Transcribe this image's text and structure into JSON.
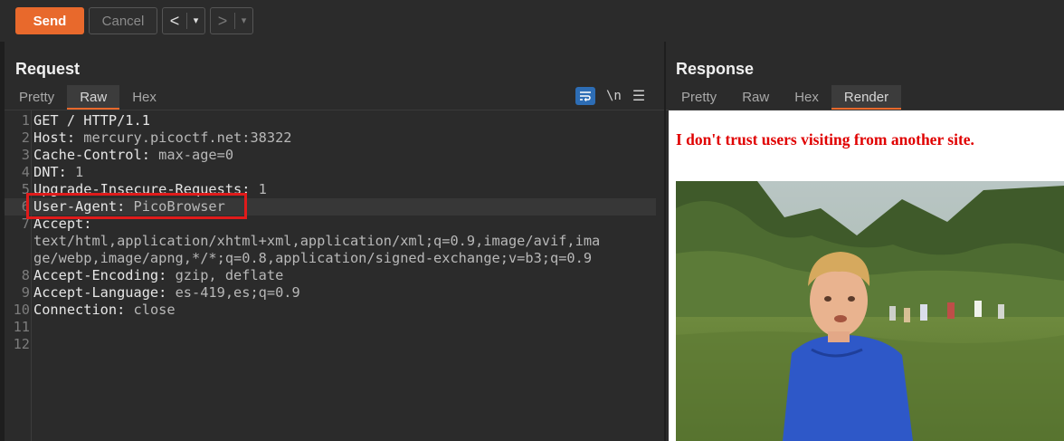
{
  "toolbar": {
    "send_label": "Send",
    "cancel_label": "Cancel",
    "back_arrow": "<",
    "forward_arrow": ">",
    "dropdown": "▾"
  },
  "request": {
    "title": "Request",
    "tabs": [
      "Pretty",
      "Raw",
      "Hex"
    ],
    "active_tab": "Raw",
    "icons": {
      "wrap": "wrap-lines-icon",
      "newline_label": "\\n",
      "menu": "hamburger-menu-icon"
    },
    "lines": [
      {
        "num": "1",
        "key": "GET / HTTP/1.1",
        "val": ""
      },
      {
        "num": "2",
        "key": "Host:",
        "val": " mercury.picoctf.net:38322"
      },
      {
        "num": "3",
        "key": "Cache-Control:",
        "val": " max-age=0"
      },
      {
        "num": "4",
        "key": "DNT:",
        "val": " 1"
      },
      {
        "num": "5",
        "key": "Upgrade-Insecure-Requests:",
        "val": " 1"
      },
      {
        "num": "6",
        "key": "User-Agent:",
        "val": " PicoBrowser"
      },
      {
        "num": "7",
        "key": "Accept:",
        "val": ""
      },
      {
        "num": "",
        "key": "text/html,application/xhtml+xml,application/xml;q=0.9,image/avif,ima",
        "val": ""
      },
      {
        "num": "",
        "key": "ge/webp,image/apng,*/*;q=0.8,application/signed-exchange;v=b3;q=0.9",
        "val": ""
      },
      {
        "num": "8",
        "key": "Accept-Encoding:",
        "val": " gzip, deflate"
      },
      {
        "num": "9",
        "key": "Accept-Language:",
        "val": " es-419,es;q=0.9"
      },
      {
        "num": "10",
        "key": "Connection:",
        "val": " close"
      },
      {
        "num": "11",
        "key": "",
        "val": ""
      },
      {
        "num": "12",
        "key": "",
        "val": ""
      }
    ]
  },
  "response": {
    "title": "Response",
    "tabs": [
      "Pretty",
      "Raw",
      "Hex",
      "Render"
    ],
    "active_tab": "Render",
    "render_message": "I don't trust users visiting from another site.",
    "image_desc": "kid-in-field-image"
  },
  "colors": {
    "accent": "#e8692c",
    "highlight_box": "#e01b1b",
    "render_text": "#e00000"
  }
}
